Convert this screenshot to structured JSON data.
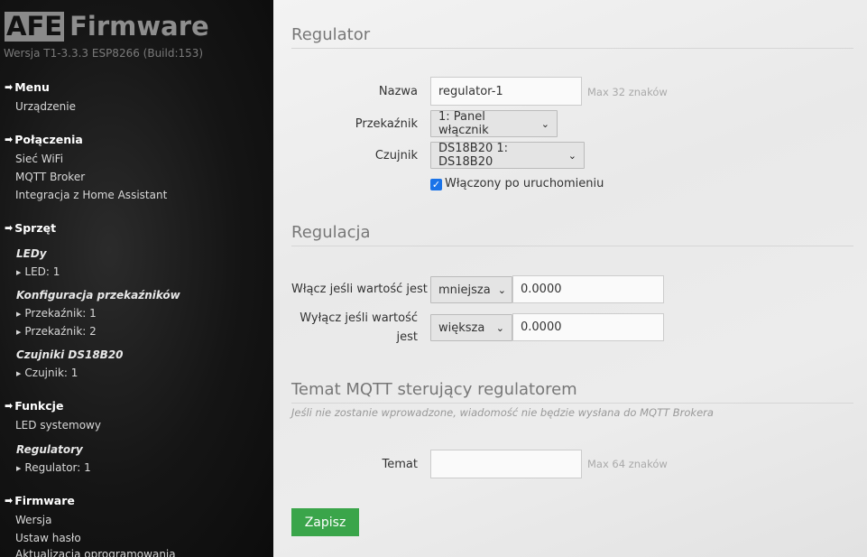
{
  "sidebar": {
    "logo_box": "AFE",
    "logo_text": "Firmware",
    "version": "Wersja T1-3.3.3 ESP8266 (Build:153)",
    "menu": {
      "title": "Menu",
      "links": [
        "Urządzenie"
      ]
    },
    "connections": {
      "title": "Połączenia",
      "links": [
        "Sieć WiFi",
        "MQTT Broker",
        "Integracja z Home Assistant"
      ]
    },
    "hardware": {
      "title": "Sprzęt",
      "leds_title": "LEDy",
      "leds": [
        "LED: 1"
      ],
      "relays_title": "Konfiguracja przekaźników",
      "relays": [
        "Przekaźnik: 1",
        "Przekaźnik: 2"
      ],
      "sensors_title": "Czujniki DS18B20",
      "sensors": [
        "Czujnik: 1"
      ]
    },
    "functions": {
      "title": "Funkcje",
      "links": [
        "LED systemowy"
      ],
      "regulators_title": "Regulatory",
      "regulators": [
        "Regulator: 1"
      ]
    },
    "firmware": {
      "title": "Firmware",
      "links": [
        "Wersja",
        "Ustaw hasło",
        "Aktualizacja oprogramowania"
      ]
    }
  },
  "main": {
    "regulator": {
      "title": "Regulator",
      "name_label": "Nazwa",
      "name_value": "regulator-1",
      "name_hint": "Max 32 znaków",
      "relay_label": "Przekaźnik",
      "relay_selected": "1: Panel włącznik",
      "sensor_label": "Czujnik",
      "sensor_selected": "DS18B20 1: DS18B20",
      "enabled_label": "Włączony po uruchomieniu",
      "enabled_checked": true
    },
    "regulation": {
      "title": "Regulacja",
      "on_label": "Włącz jeśli wartość jest",
      "on_condition": "mniejsza",
      "on_value": "0.0000",
      "off_label_1": "Wyłącz jeśli wartość",
      "off_label_2": "jest",
      "off_condition": "większa",
      "off_value": "0.0000"
    },
    "mqtt": {
      "title": "Temat MQTT sterujący regulatorem",
      "note": "Jeśli nie zostanie wprowadzone, wiadomość nie będzie wysłana do MQTT Brokera",
      "topic_label": "Temat",
      "topic_value": "",
      "topic_hint": "Max 64 znaków"
    },
    "save_label": "Zapisz"
  },
  "colors": {
    "save_button": "#3aa54a",
    "checkbox": "#1a73e8",
    "sidebar_bg": "#151515"
  }
}
